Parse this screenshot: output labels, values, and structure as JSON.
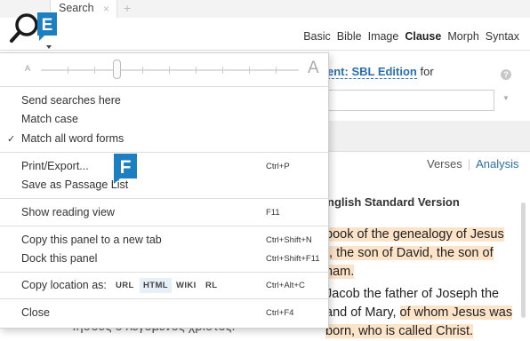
{
  "tabs": {
    "active_label": "Search",
    "close_glyph": "×",
    "new_glyph": "+"
  },
  "logo": {
    "letter": "E",
    "icon": "search-magnifier-e-logo"
  },
  "search_kinds": [
    "Basic",
    "Bible",
    "Image",
    "Clause",
    "Morph",
    "Syntax"
  ],
  "active_kind": "Clause",
  "edition": {
    "name": "ent: SBL Edition",
    "suffix": "for"
  },
  "help_glyph": "?",
  "view_tabs": {
    "verses": "Verses",
    "separator": "|",
    "analysis": "Analysis"
  },
  "version_title": "nglish Standard Version",
  "verses": {
    "v1_lines": [
      "book of the genealogy of Jesus",
      "t, the son of David, the son of",
      "ham."
    ],
    "v2_lines": [
      "Jacob the father of Joseph the",
      "and of Mary, ",
      "of whom Jesus was",
      "born, who is called Christ."
    ]
  },
  "greek_text": "Ἰησοῦς ὁ λεγόμενος χριστός.",
  "menu": {
    "font_small": "A",
    "font_large": "A",
    "items": {
      "send_searches": "Send searches here",
      "match_case": "Match case",
      "match_all": "Match all word forms",
      "print_export": "Print/Export...",
      "save_passage": "Save as Passage List",
      "show_reading": "Show reading view",
      "copy_panel": "Copy this panel to a new tab",
      "dock_panel": "Dock this panel",
      "copy_location": "Copy location as:",
      "close": "Close"
    },
    "shortcuts": {
      "print_export": "Ctrl+P",
      "show_reading": "F11",
      "copy_panel": "Ctrl+Shift+N",
      "dock_panel": "Ctrl+Shift+F11",
      "copy_location": "Ctrl+Alt+C",
      "close": "Ctrl+F4"
    },
    "check_glyph": "✓",
    "formats": [
      "URL",
      "HTML",
      "WIKI",
      "RL"
    ],
    "selected_format": "HTML",
    "overlay_letter": "F"
  },
  "colors": {
    "accent_blue": "#2a6fb0",
    "highlight": "#fde3c8",
    "logo_blue": "#1e7fc0"
  }
}
